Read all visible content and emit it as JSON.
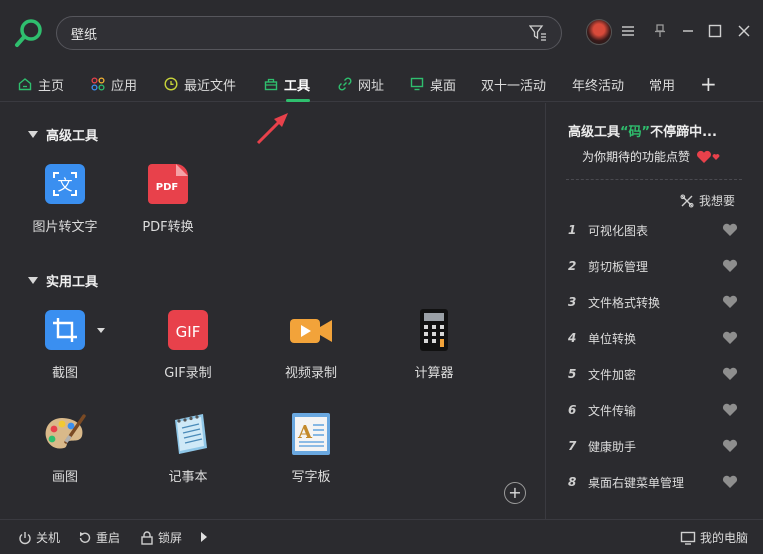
{
  "search": {
    "value": "壁纸"
  },
  "window_controls": [
    "menu-icon",
    "pin-icon",
    "minimize-icon",
    "maximize-icon",
    "close-icon"
  ],
  "nav": {
    "items": [
      {
        "label": "主页",
        "icon": "home-icon"
      },
      {
        "label": "应用",
        "icon": "apps-icon"
      },
      {
        "label": "最近文件",
        "icon": "clock-icon"
      },
      {
        "label": "工具",
        "icon": "toolbox-icon",
        "active": true
      },
      {
        "label": "网址",
        "icon": "link-icon"
      },
      {
        "label": "桌面",
        "icon": "monitor-icon"
      },
      {
        "label": "双十一活动"
      },
      {
        "label": "年终活动"
      },
      {
        "label": "常用"
      }
    ],
    "add": "+"
  },
  "sections": {
    "advanced": {
      "title": "高级工具",
      "tools": [
        {
          "label": "图片转文字",
          "icon": "image-to-text-icon"
        },
        {
          "label": "PDF转换",
          "icon": "pdf-icon",
          "icon_text": "PDF"
        }
      ]
    },
    "practical": {
      "title": "实用工具",
      "tools": [
        {
          "label": "截图",
          "icon": "crop-icon"
        },
        {
          "label": "GIF录制",
          "icon": "gif-icon",
          "icon_text": "GIF"
        },
        {
          "label": "视频录制",
          "icon": "video-record-icon"
        },
        {
          "label": "计算器",
          "icon": "calculator-icon"
        },
        {
          "label": "画图",
          "icon": "paint-palette-icon"
        },
        {
          "label": "记事本",
          "icon": "notepad-icon"
        },
        {
          "label": "写字板",
          "icon": "wordpad-icon"
        }
      ]
    }
  },
  "right_panel": {
    "title_prefix": "高级工具",
    "title_quote": "“码”",
    "title_suffix": "不停蹄中...",
    "subtitle": "为你期待的功能点赞",
    "want_label": "我想要",
    "items": [
      {
        "num": "1",
        "label": "可视化图表"
      },
      {
        "num": "2",
        "label": "剪切板管理"
      },
      {
        "num": "3",
        "label": "文件格式转换"
      },
      {
        "num": "4",
        "label": "单位转换"
      },
      {
        "num": "5",
        "label": "文件加密"
      },
      {
        "num": "6",
        "label": "文件传输"
      },
      {
        "num": "7",
        "label": "健康助手"
      },
      {
        "num": "8",
        "label": "桌面右键菜单管理"
      }
    ]
  },
  "bottom": {
    "shutdown": "关机",
    "restart": "重启",
    "lock": "锁屏",
    "my_computer": "我的电脑"
  },
  "colors": {
    "background": "#2b2b2f",
    "accent": "#2fbf6e",
    "heart_red": "#e8414b"
  }
}
